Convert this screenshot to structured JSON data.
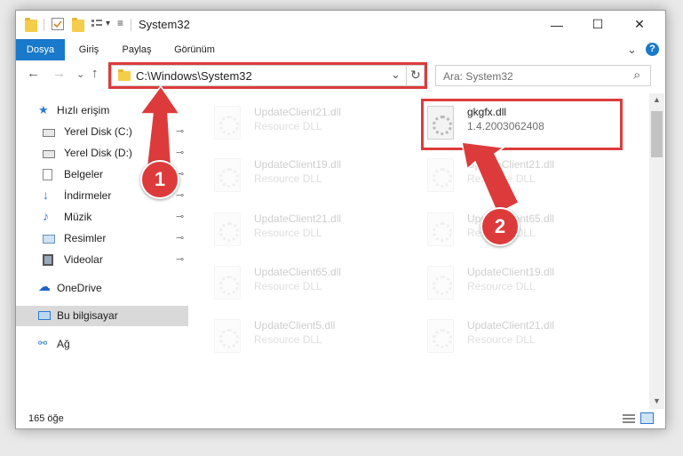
{
  "window": {
    "title": "System32",
    "minimize": "—",
    "maximize": "☐",
    "close": "✕"
  },
  "ribbon": {
    "tabs": [
      "Dosya",
      "Giriş",
      "Paylaş",
      "Görünüm"
    ],
    "expand_glyph": "⌄",
    "help_glyph": "?"
  },
  "address": {
    "back": "←",
    "forward": "→",
    "recent": "⌄",
    "up": "↑",
    "path": "C:\\Windows\\System32",
    "dropdown": "⌄",
    "refresh": "↻"
  },
  "search": {
    "placeholder": "Ara: System32",
    "icon": "⌕"
  },
  "nav": {
    "items": [
      {
        "label": "Hızlı erişim",
        "icon": "star-icon",
        "pinned": false
      },
      {
        "label": "Yerel Disk (C:)",
        "icon": "drive-icon",
        "pinned": true
      },
      {
        "label": "Yerel Disk (D:)",
        "icon": "drive-icon",
        "pinned": true
      },
      {
        "label": "Belgeler",
        "icon": "document-icon",
        "pinned": true
      },
      {
        "label": "İndirmeler",
        "icon": "download-icon",
        "pinned": true
      },
      {
        "label": "Müzik",
        "icon": "music-icon",
        "pinned": true
      },
      {
        "label": "Resimler",
        "icon": "pictures-icon",
        "pinned": true
      },
      {
        "label": "Videolar",
        "icon": "video-icon",
        "pinned": true
      },
      {
        "label": "OneDrive",
        "icon": "cloud-icon",
        "pinned": false
      },
      {
        "label": "Bu bilgisayar",
        "icon": "computer-icon",
        "pinned": false
      },
      {
        "label": "Ağ",
        "icon": "network-icon",
        "pinned": false
      }
    ],
    "pin_glyph": "📌"
  },
  "files": [
    {
      "name": "UpdateClient21.dll",
      "type": "Resource DLL"
    },
    {
      "name": "gkgfx.dll",
      "type": "1.4.2003062408"
    },
    {
      "name": "UpdateClient19.dll",
      "type": "Resource DLL"
    },
    {
      "name": "UpdateClient21.dll",
      "type": "Resource DLL"
    },
    {
      "name": "UpdateClient21.dll",
      "type": "Resource DLL"
    },
    {
      "name": "UpdateClient65.dll",
      "type": "Resource DLL"
    },
    {
      "name": "UpdateClient65.dll",
      "type": "Resource DLL"
    },
    {
      "name": "UpdateClient19.dll",
      "type": "Resource DLL"
    },
    {
      "name": "UpdateClient5.dll",
      "type": "Resource DLL"
    },
    {
      "name": "UpdateClient21.dll",
      "type": "Resource DLL"
    }
  ],
  "status": {
    "count": "165 öğe"
  },
  "annotations": {
    "badge1": "1",
    "badge2": "2",
    "color": "#dd3b3b"
  },
  "colors": {
    "file_tab": "#1979ca",
    "selected_nav": "#d9d9d9"
  }
}
